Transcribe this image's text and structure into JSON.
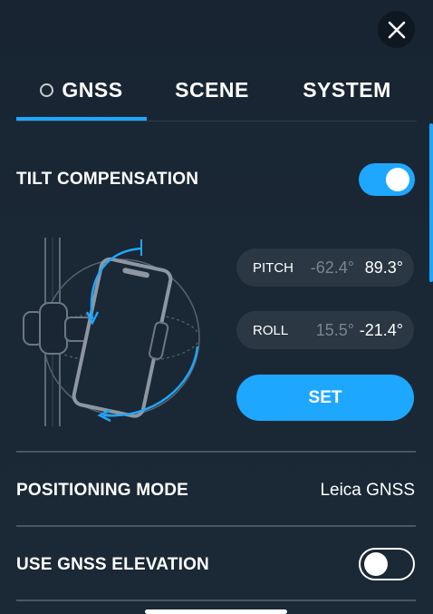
{
  "tabs": [
    {
      "label": "GNSS",
      "selected": true
    },
    {
      "label": "SCENE",
      "selected": false
    },
    {
      "label": "SYSTEM",
      "selected": false
    }
  ],
  "tilt": {
    "label": "TILT COMPENSATION",
    "enabled": true,
    "pitch": {
      "label": "PITCH",
      "previous": "-62.4°",
      "current": "89.3°"
    },
    "roll": {
      "label": "ROLL",
      "previous": "15.5°",
      "current": "-21.4°"
    },
    "set_label": "SET"
  },
  "positioning": {
    "label": "POSITIONING MODE",
    "value": "Leica GNSS"
  },
  "elevation": {
    "label": "USE GNSS ELEVATION",
    "enabled": false
  },
  "icons": {
    "close": "close-icon",
    "tab_radio": "radio-icon",
    "illustration": "phone-tilt-illustration"
  },
  "colors": {
    "accent": "#1ea7ff",
    "background": "#1a2633",
    "pill": "#2b3743"
  }
}
